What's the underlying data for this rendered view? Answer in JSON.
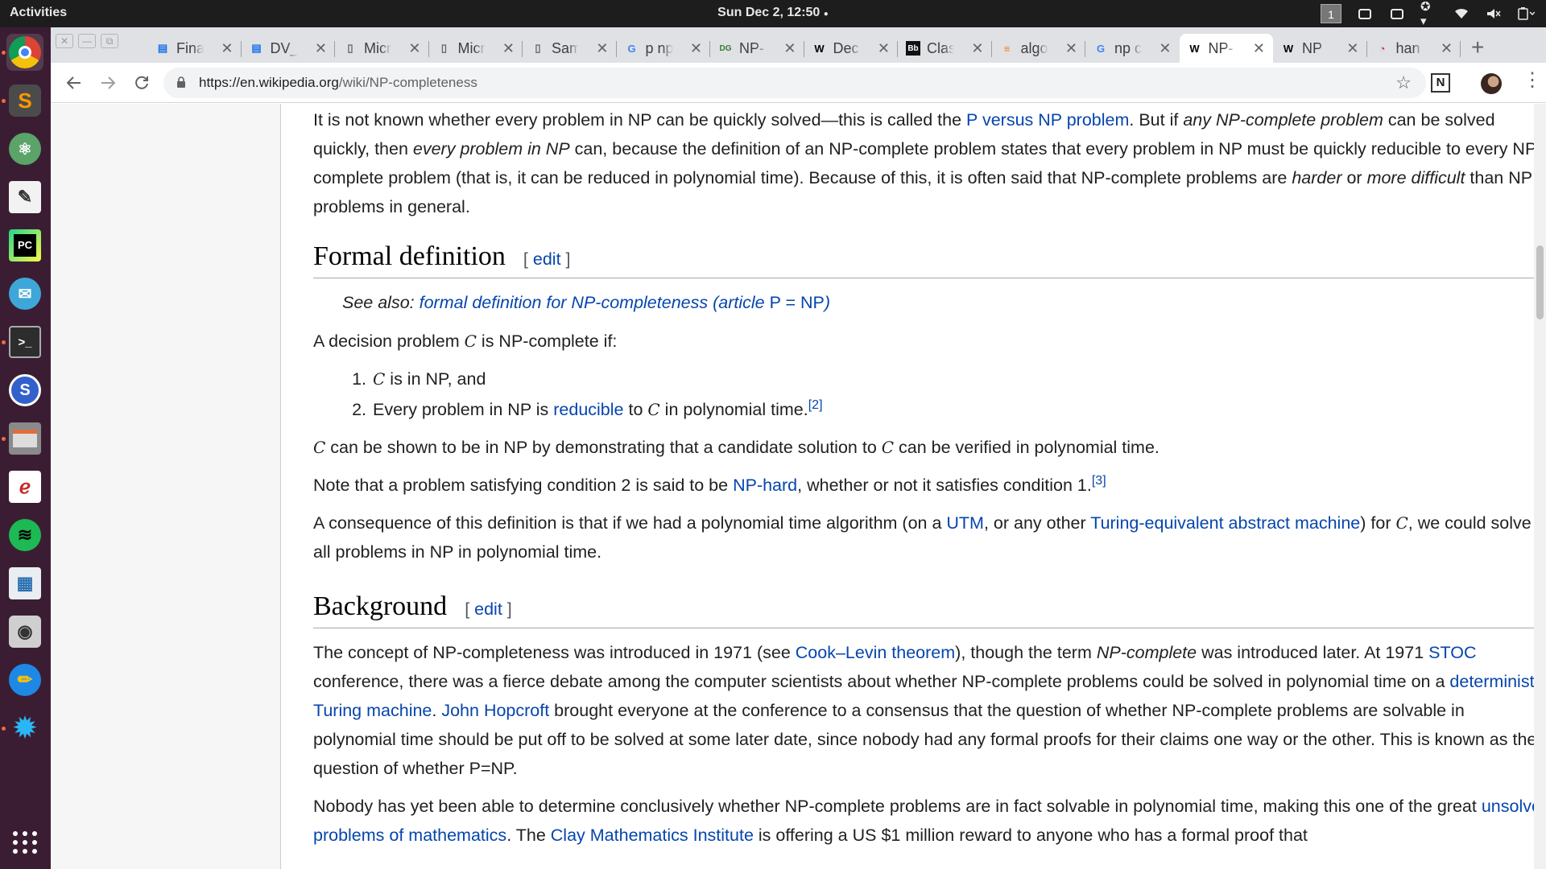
{
  "system": {
    "activities": "Activities",
    "clock": "Sun Dec  2, 12:50",
    "workspace": "1"
  },
  "dock": {
    "apps": [
      "chrome-icon",
      "sublime-text-icon",
      "atom-icon",
      "text-editor-icon",
      "pycharm-icon",
      "mail-icon",
      "terminal-icon",
      "simplenote-icon",
      "files-icon",
      "eclipse-icon",
      "spotify-icon",
      "document-viewer-icon",
      "screenshot-icon",
      "pinta-icon",
      "settings-icon",
      "show-applications-icon"
    ]
  },
  "browser": {
    "tabs": [
      {
        "label": "Final",
        "icon": "docs"
      },
      {
        "label": "DV_",
        "icon": "docs"
      },
      {
        "label": "Micr",
        "icon": "doc"
      },
      {
        "label": "Micr",
        "icon": "doc"
      },
      {
        "label": "Sam",
        "icon": "doc"
      },
      {
        "label": "p np",
        "icon": "google"
      },
      {
        "label": "NP-",
        "icon": "dg"
      },
      {
        "label": "Dec",
        "icon": "wikipedia"
      },
      {
        "label": "Clas",
        "icon": "bb"
      },
      {
        "label": "algo",
        "icon": "stackoverflow"
      },
      {
        "label": "np c",
        "icon": "google"
      },
      {
        "label": "NP-",
        "icon": "wikipedia",
        "active": true
      },
      {
        "label": "NP",
        "icon": "wikipedia"
      },
      {
        "label": "han",
        "icon": "misc"
      }
    ],
    "url_host": "https://en.wikipedia.org",
    "url_path": "/wiki/NP-completeness"
  },
  "article": {
    "intro": {
      "s1_pre": "It is not known whether every problem in NP can be quickly solved—this is called the ",
      "s1_link": "P versus NP problem",
      "s1_post": ". But if ",
      "s1_em1": "any NP-complete problem",
      "s1_mid": " can be solved quickly, then ",
      "s1_em2": "every problem in NP",
      "s1_rest": " can, because the definition of an NP-complete problem states that every problem in NP must be quickly reducible to every NP-complete problem (that is, it can be reduced in polynomial time). Because of this, it is often said that NP-complete problems are ",
      "s1_em3": "harder",
      "s1_or": " or ",
      "s1_em4": "more difficult",
      "s1_end": " than NP problems in general."
    },
    "formal": {
      "heading": "Formal definition",
      "edit_open": "[ ",
      "edit_label": "edit",
      "edit_close": " ]",
      "see_also_pre": "See also: ",
      "see_also_link": "formal definition for NP-completeness (article ",
      "see_also_link2": "P = NP",
      "see_also_link3": ")",
      "decision_pre": "A decision problem ",
      "var": "C",
      "decision_post": " is NP-complete if:",
      "cond1_post": " is in NP, and",
      "cond2_pre": "Every problem in NP is ",
      "cond2_link": "reducible",
      "cond2_mid": " to ",
      "cond2_post": " in polynomial time.",
      "ref2": "[2]",
      "shown_mid": " can be shown to be in NP by demonstrating that a candidate solution to ",
      "shown_post": " can be verified in polynomial time.",
      "note_pre": "Note that a problem satisfying condition 2 is said to be ",
      "note_link": "NP-hard",
      "note_post": ", whether or not it satisfies condition 1.",
      "ref3": "[3]",
      "cons_pre": "A consequence of this definition is that if we had a polynomial time algorithm (on a ",
      "cons_link1": "UTM",
      "cons_mid": ", or any other ",
      "cons_link2": "Turing-equivalent abstract machine",
      "cons_for": ") for ",
      "cons_post": ", we could solve all problems in NP in polynomial time."
    },
    "background": {
      "heading": "Background",
      "edit_open": "[ ",
      "edit_label": "edit",
      "edit_close": " ]",
      "p1_a": "The concept of NP-completeness was introduced in 1971 (see ",
      "p1_link1": "Cook–Levin theorem",
      "p1_b": "), though the term ",
      "p1_em": "NP-complete",
      "p1_c": " was introduced later. At 1971 ",
      "p1_link2": "STOC",
      "p1_d": " conference, there was a fierce debate among the computer scientists about whether NP-complete problems could be solved in polynomial time on a ",
      "p1_link3": "deterministic Turing machine",
      "p1_e": ". ",
      "p1_link4": "John Hopcroft",
      "p1_f": " brought everyone at the conference to a consensus that the question of whether NP-complete problems are solvable in polynomial time should be put off to be solved at some later date, since nobody had any formal proofs for their claims one way or the other. This is known as the question of whether P=NP.",
      "p2_a": "Nobody has yet been able to determine conclusively whether NP-complete problems are in fact solvable in polynomial time, making this one of the great ",
      "p2_link1": "unsolved problems of mathematics",
      "p2_b": ". The ",
      "p2_link2": "Clay Mathematics Institute",
      "p2_c": " is offering a US $1 million reward to anyone who has a formal proof that"
    }
  }
}
